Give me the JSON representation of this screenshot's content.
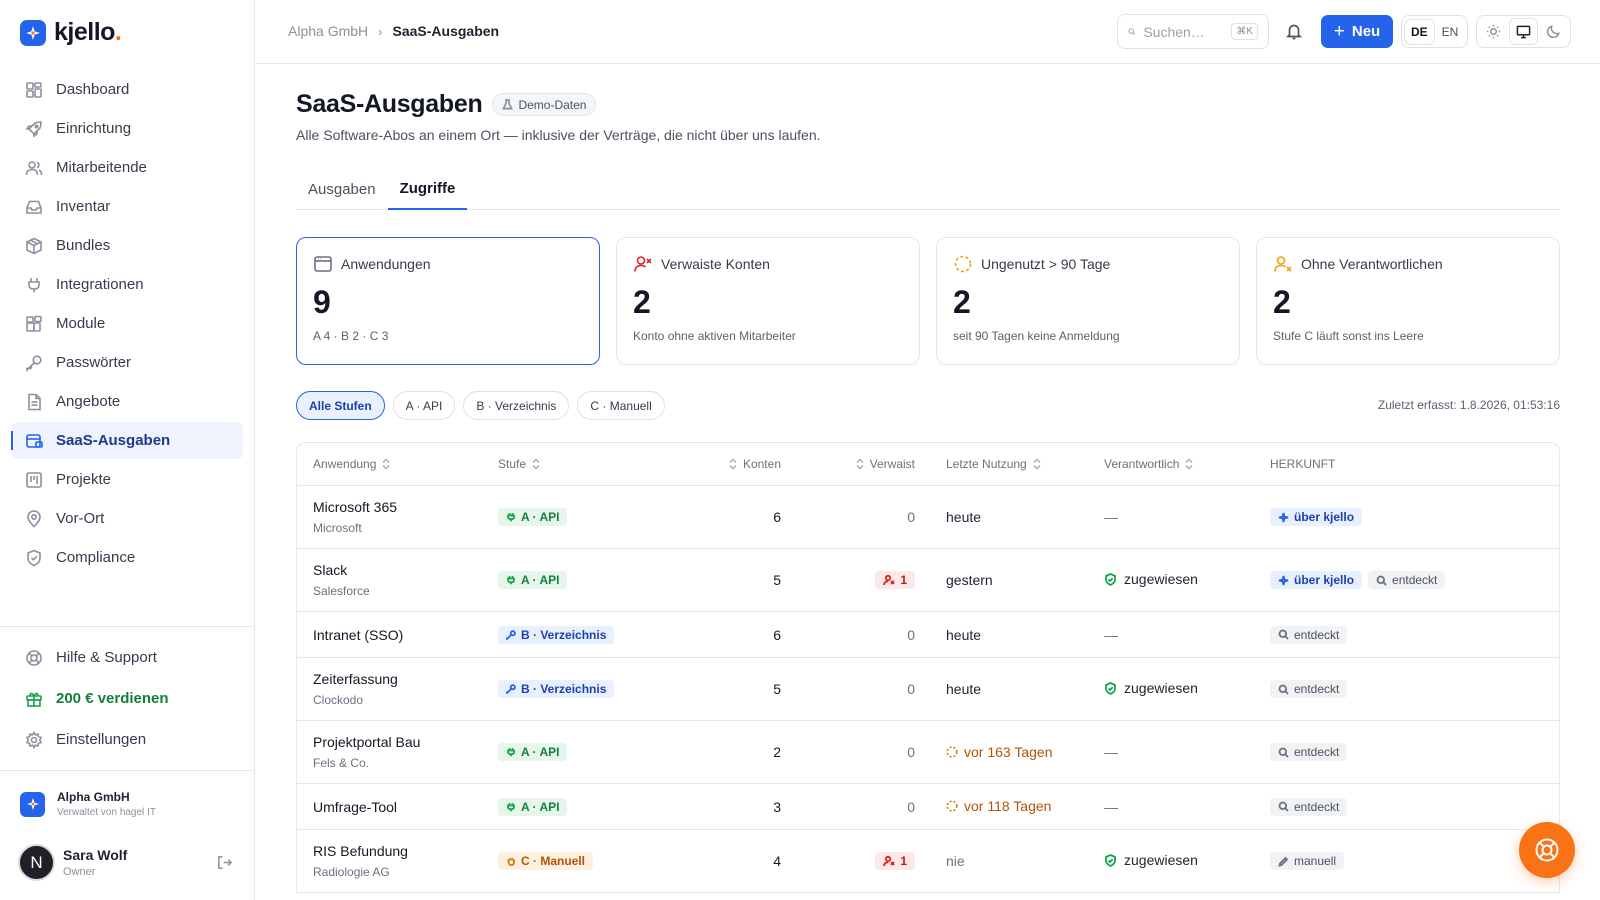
{
  "brand": {
    "name": "kjello",
    "dot": "."
  },
  "sidebar": {
    "items": [
      {
        "label": "Dashboard",
        "icon": "dashboard-icon"
      },
      {
        "label": "Einrichtung",
        "icon": "rocket-icon"
      },
      {
        "label": "Mitarbeitende",
        "icon": "users-icon"
      },
      {
        "label": "Inventar",
        "icon": "inbox-icon"
      },
      {
        "label": "Bundles",
        "icon": "package-icon"
      },
      {
        "label": "Integrationen",
        "icon": "plug-icon"
      },
      {
        "label": "Module",
        "icon": "blocks-icon"
      },
      {
        "label": "Passwörter",
        "icon": "key-icon"
      },
      {
        "label": "Angebote",
        "icon": "document-icon"
      },
      {
        "label": "SaaS-Ausgaben",
        "icon": "card-icon",
        "active": true
      },
      {
        "label": "Projekte",
        "icon": "kanban-icon"
      },
      {
        "label": "Vor-Ort",
        "icon": "map-pin-icon"
      },
      {
        "label": "Compliance",
        "icon": "shield-icon"
      }
    ],
    "bottom": {
      "help": "Hilfe & Support",
      "referral": "200 € verdienen",
      "settings": "Einstellungen"
    },
    "org": {
      "name": "Alpha GmbH",
      "managed_by": "Verwaltet von hagel IT"
    },
    "user": {
      "initial": "N",
      "name": "Sara Wolf",
      "role": "Owner"
    }
  },
  "topbar": {
    "breadcrumb": [
      "Alpha GmbH",
      "SaaS-Ausgaben"
    ],
    "search_placeholder": "Suchen…",
    "search_shortcut": "⌘K",
    "new_label": "Neu",
    "languages": [
      "DE",
      "EN"
    ],
    "active_language": "DE"
  },
  "page": {
    "title": "SaaS-Ausgaben",
    "badge": "Demo-Daten",
    "subtitle": "Alle Software-Abos an einem Ort — inklusive der Verträge, die nicht über uns laufen.",
    "tabs": [
      "Ausgaben",
      "Zugriffe"
    ],
    "active_tab": "Zugriffe"
  },
  "stats": [
    {
      "label": "Anwendungen",
      "value": "9",
      "note": "A 4 · B 2 · C 3",
      "color": "#6b7180"
    },
    {
      "label": "Verwaiste Konten",
      "value": "2",
      "note": "Konto ohne aktiven Mitarbeiter",
      "color": "#dc2626"
    },
    {
      "label": "Ungenutzt > 90 Tage",
      "value": "2",
      "note": "seit 90 Tagen keine Anmeldung",
      "color": "#f59e0b"
    },
    {
      "label": "Ohne Verantwortlichen",
      "value": "2",
      "note": "Stufe C läuft sonst ins Leere",
      "color": "#f59e0b"
    }
  ],
  "filters": [
    "Alle Stufen",
    "A · API",
    "B · Verzeichnis",
    "C · Manuell"
  ],
  "captured": "Zuletzt erfasst: 1.8.2026, 01:53:16",
  "table": {
    "headers": [
      "Anwendung",
      "Stufe",
      "Konten",
      "Verwaist",
      "Letzte Nutzung",
      "Verantwortlich",
      "HERKUNFT"
    ],
    "rows": [
      {
        "name": "Microsoft 365",
        "vendor": "Microsoft",
        "tier": "A · API",
        "tier_class": "a",
        "accounts": "6",
        "orphaned": "0",
        "last_used": "heute",
        "last_class": "",
        "owner": "—",
        "sources": [
          {
            "label": "über kjello",
            "kind": "kjello"
          }
        ]
      },
      {
        "name": "Slack",
        "vendor": "Salesforce",
        "tier": "A · API",
        "tier_class": "a",
        "accounts": "5",
        "orphaned": "1",
        "last_used": "gestern",
        "last_class": "",
        "owner": "zugewiesen",
        "sources": [
          {
            "label": "über kjello",
            "kind": "kjello"
          },
          {
            "label": "entdeckt",
            "kind": "found"
          }
        ]
      },
      {
        "name": "Intranet (SSO)",
        "vendor": "",
        "tier": "B · Verzeichnis",
        "tier_class": "b",
        "accounts": "6",
        "orphaned": "0",
        "last_used": "heute",
        "last_class": "",
        "owner": "—",
        "sources": [
          {
            "label": "entdeckt",
            "kind": "found"
          }
        ]
      },
      {
        "name": "Zeiterfassung",
        "vendor": "Clockodo",
        "tier": "B · Verzeichnis",
        "tier_class": "b",
        "accounts": "5",
        "orphaned": "0",
        "last_used": "heute",
        "last_class": "",
        "owner": "zugewiesen",
        "sources": [
          {
            "label": "entdeckt",
            "kind": "found"
          }
        ]
      },
      {
        "name": "Projektportal Bau",
        "vendor": "Fels & Co.",
        "tier": "A · API",
        "tier_class": "a",
        "accounts": "2",
        "orphaned": "0",
        "last_used": "vor 163 Tagen",
        "last_class": "stale",
        "owner": "—",
        "sources": [
          {
            "label": "entdeckt",
            "kind": "found"
          }
        ]
      },
      {
        "name": "Umfrage-Tool",
        "vendor": "",
        "tier": "A · API",
        "tier_class": "a",
        "accounts": "3",
        "orphaned": "0",
        "last_used": "vor 118 Tagen",
        "last_class": "stale",
        "owner": "—",
        "sources": [
          {
            "label": "entdeckt",
            "kind": "found"
          }
        ]
      },
      {
        "name": "RIS Befundung",
        "vendor": "Radiologie AG",
        "tier": "C · Manuell",
        "tier_class": "c",
        "accounts": "4",
        "orphaned": "1",
        "last_used": "nie",
        "last_class": "never",
        "owner": "zugewiesen",
        "sources": [
          {
            "label": "manuell",
            "kind": "manual"
          }
        ]
      }
    ]
  },
  "colors": {
    "accent": "#2563eb",
    "fab": "#f97316"
  }
}
